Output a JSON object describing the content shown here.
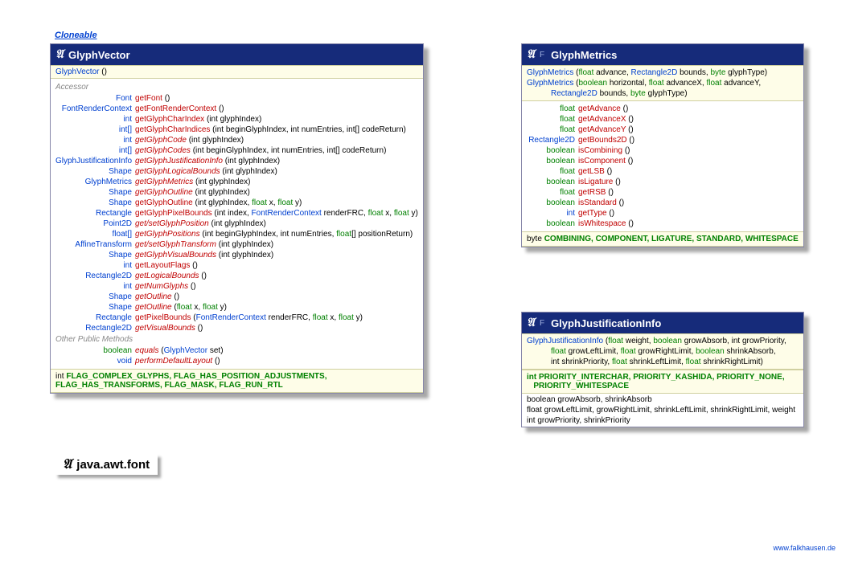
{
  "package": "java.awt.font",
  "cloneable": "Cloneable",
  "footer": "www.falkhausen.de",
  "gv": {
    "title": "GlyphVector",
    "ctor": "GlyphVector",
    "accessorsLabel": "Accessor",
    "otherLabel": "Other Public Methods",
    "rows": [
      {
        "ret": "Font",
        "m": "getFont",
        "p": "()"
      },
      {
        "ret": "FontRenderContext",
        "m": "getFontRenderContext",
        "p": "()"
      },
      {
        "ret": "int",
        "m": "getGlyphCharIndex",
        "p": "(int glyphIndex)"
      },
      {
        "ret": "int[]",
        "m": "getGlyphCharIndices",
        "p": "(int beginGlyphIndex, int numEntries, int[] codeReturn)"
      },
      {
        "ret": "int",
        "m": "getGlyphCode",
        "p": "(int glyphIndex)",
        "it": true
      },
      {
        "ret": "int[]",
        "m": "getGlyphCodes",
        "p": "(int beginGlyphIndex, int numEntries, int[] codeReturn)",
        "it": true
      },
      {
        "ret": "GlyphJustificationInfo",
        "m": "getGlyphJustificationInfo",
        "p": "(int glyphIndex)",
        "it": true
      },
      {
        "ret": "Shape",
        "m": "getGlyphLogicalBounds",
        "p": "(int glyphIndex)",
        "it": true
      },
      {
        "ret": "GlyphMetrics",
        "m": "getGlyphMetrics",
        "p": "(int glyphIndex)",
        "it": true
      },
      {
        "ret": "Shape",
        "m": "getGlyphOutline",
        "p": "(int glyphIndex)",
        "it": true
      },
      {
        "ret": "Shape",
        "m": "getGlyphOutline",
        "p": "(int glyphIndex, float x, float y)",
        "fx": true
      },
      {
        "ret": "Rectangle",
        "m": "getGlyphPixelBounds",
        "p": "(int index, FontRenderContext renderFRC, float x, float y)",
        "frc": true,
        "fx": true
      },
      {
        "ret": "Point2D",
        "m": "get/setGlyphPosition",
        "p": "(int glyphIndex)",
        "it": true
      },
      {
        "ret": "float[]",
        "m": "getGlyphPositions",
        "p": "(int beginGlyphIndex, int numEntries, float[] positionReturn)",
        "it": true,
        "fx": true
      },
      {
        "ret": "AffineTransform",
        "m": "get/setGlyphTransform",
        "p": "(int glyphIndex)",
        "it": true
      },
      {
        "ret": "Shape",
        "m": "getGlyphVisualBounds",
        "p": "(int glyphIndex)",
        "it": true
      },
      {
        "ret": "int",
        "m": "getLayoutFlags",
        "p": "()"
      },
      {
        "ret": "Rectangle2D",
        "m": "getLogicalBounds",
        "p": "()",
        "it": true
      },
      {
        "ret": "int",
        "m": "getNumGlyphs",
        "p": "()",
        "it": true
      },
      {
        "ret": "Shape",
        "m": "getOutline",
        "p": "()",
        "it": true
      },
      {
        "ret": "Shape",
        "m": "getOutline",
        "p": "(float x, float y)",
        "it": true,
        "fx": true
      },
      {
        "ret": "Rectangle",
        "m": "getPixelBounds",
        "p": "(FontRenderContext renderFRC, float x, float y)",
        "frc": true,
        "fx": true
      },
      {
        "ret": "Rectangle2D",
        "m": "getVisualBounds",
        "p": "()",
        "it": true
      }
    ],
    "other": [
      {
        "ret": "boolean",
        "m": "equals",
        "p": "(GlyphVector set)",
        "it": true,
        "tp": true,
        "rkw": true
      },
      {
        "ret": "void",
        "m": "performDefaultLayout",
        "p": "()",
        "it": true
      }
    ],
    "flags": "int FLAG_COMPLEX_GLYPHS, FLAG_HAS_POSITION_ADJUSTMENTS, FLAG_HAS_TRANSFORMS, FLAG_MASK, FLAG_RUN_RTL"
  },
  "gm": {
    "title": "GlyphMetrics",
    "mod": "F",
    "ctor1": {
      "name": "GlyphMetrics"
    },
    "ctor2": {
      "name": "GlyphMetrics"
    },
    "rows": [
      {
        "ret": "float",
        "m": "getAdvance",
        "kw": true
      },
      {
        "ret": "float",
        "m": "getAdvanceX",
        "kw": true
      },
      {
        "ret": "float",
        "m": "getAdvanceY",
        "kw": true
      },
      {
        "ret": "Rectangle2D",
        "m": "getBounds2D"
      },
      {
        "ret": "boolean",
        "m": "isCombining",
        "kw": true
      },
      {
        "ret": "boolean",
        "m": "isComponent",
        "kw": true
      },
      {
        "ret": "float",
        "m": "getLSB",
        "kw": true
      },
      {
        "ret": "boolean",
        "m": "isLigature",
        "kw": true
      },
      {
        "ret": "float",
        "m": "getRSB",
        "kw": true
      },
      {
        "ret": "boolean",
        "m": "isStandard",
        "kw": true
      },
      {
        "ret": "int",
        "m": "getType"
      },
      {
        "ret": "boolean",
        "m": "isWhitespace",
        "kw": true
      }
    ],
    "constants": "byte COMBINING, COMPONENT, LIGATURE, STANDARD, WHITESPACE"
  },
  "gji": {
    "title": "GlyphJustificationInfo",
    "mod": "F",
    "ctor": {
      "name": "GlyphJustificationInfo"
    }
  }
}
